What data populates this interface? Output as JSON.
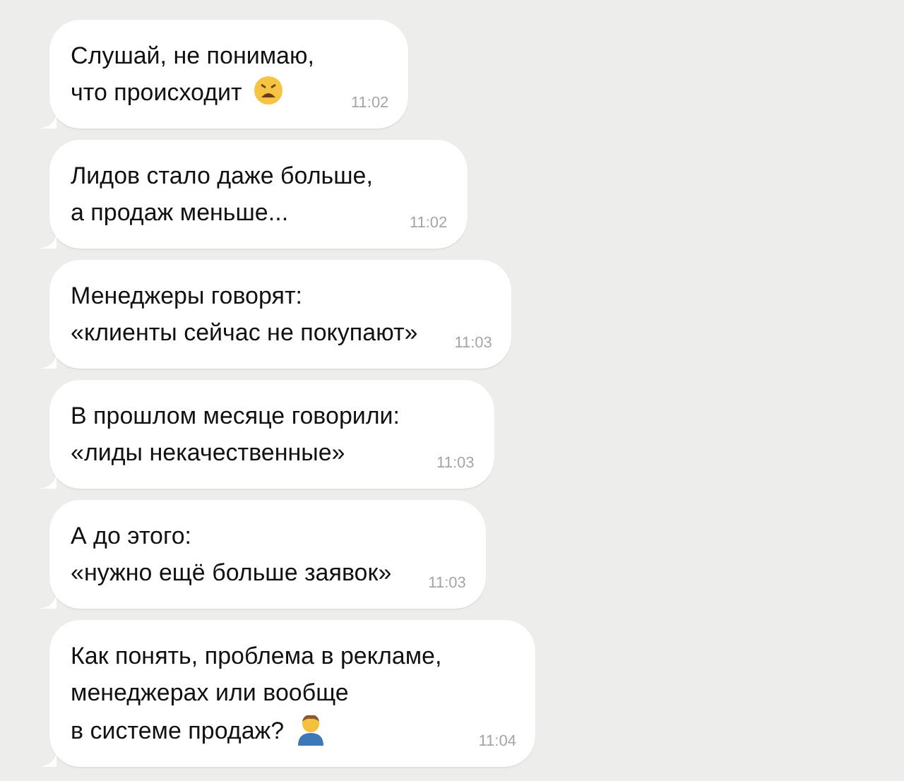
{
  "messages": [
    {
      "lines": [
        "Слушай, не понимаю,",
        "что происходит"
      ],
      "emoji": {
        "kind": "weary"
      },
      "time": "11:02"
    },
    {
      "lines": [
        "Лидов стало даже больше,",
        "а продаж меньше..."
      ],
      "time": "11:02"
    },
    {
      "lines": [
        "Менеджеры говорят:",
        "«клиенты сейчас не покупают»"
      ],
      "time": "11:03"
    },
    {
      "lines": [
        "В прошлом месяце говорили:",
        "«лиды некачественные»"
      ],
      "time": "11:03"
    },
    {
      "lines": [
        "А до этого:",
        "«нужно ещё больше заявок»"
      ],
      "time": "11:03"
    },
    {
      "lines": [
        "Как понять, проблема в рекламе,",
        "менеджерах или вообще",
        "в системе продаж?"
      ],
      "emoji": {
        "kind": "person"
      },
      "time": "11:04"
    }
  ]
}
